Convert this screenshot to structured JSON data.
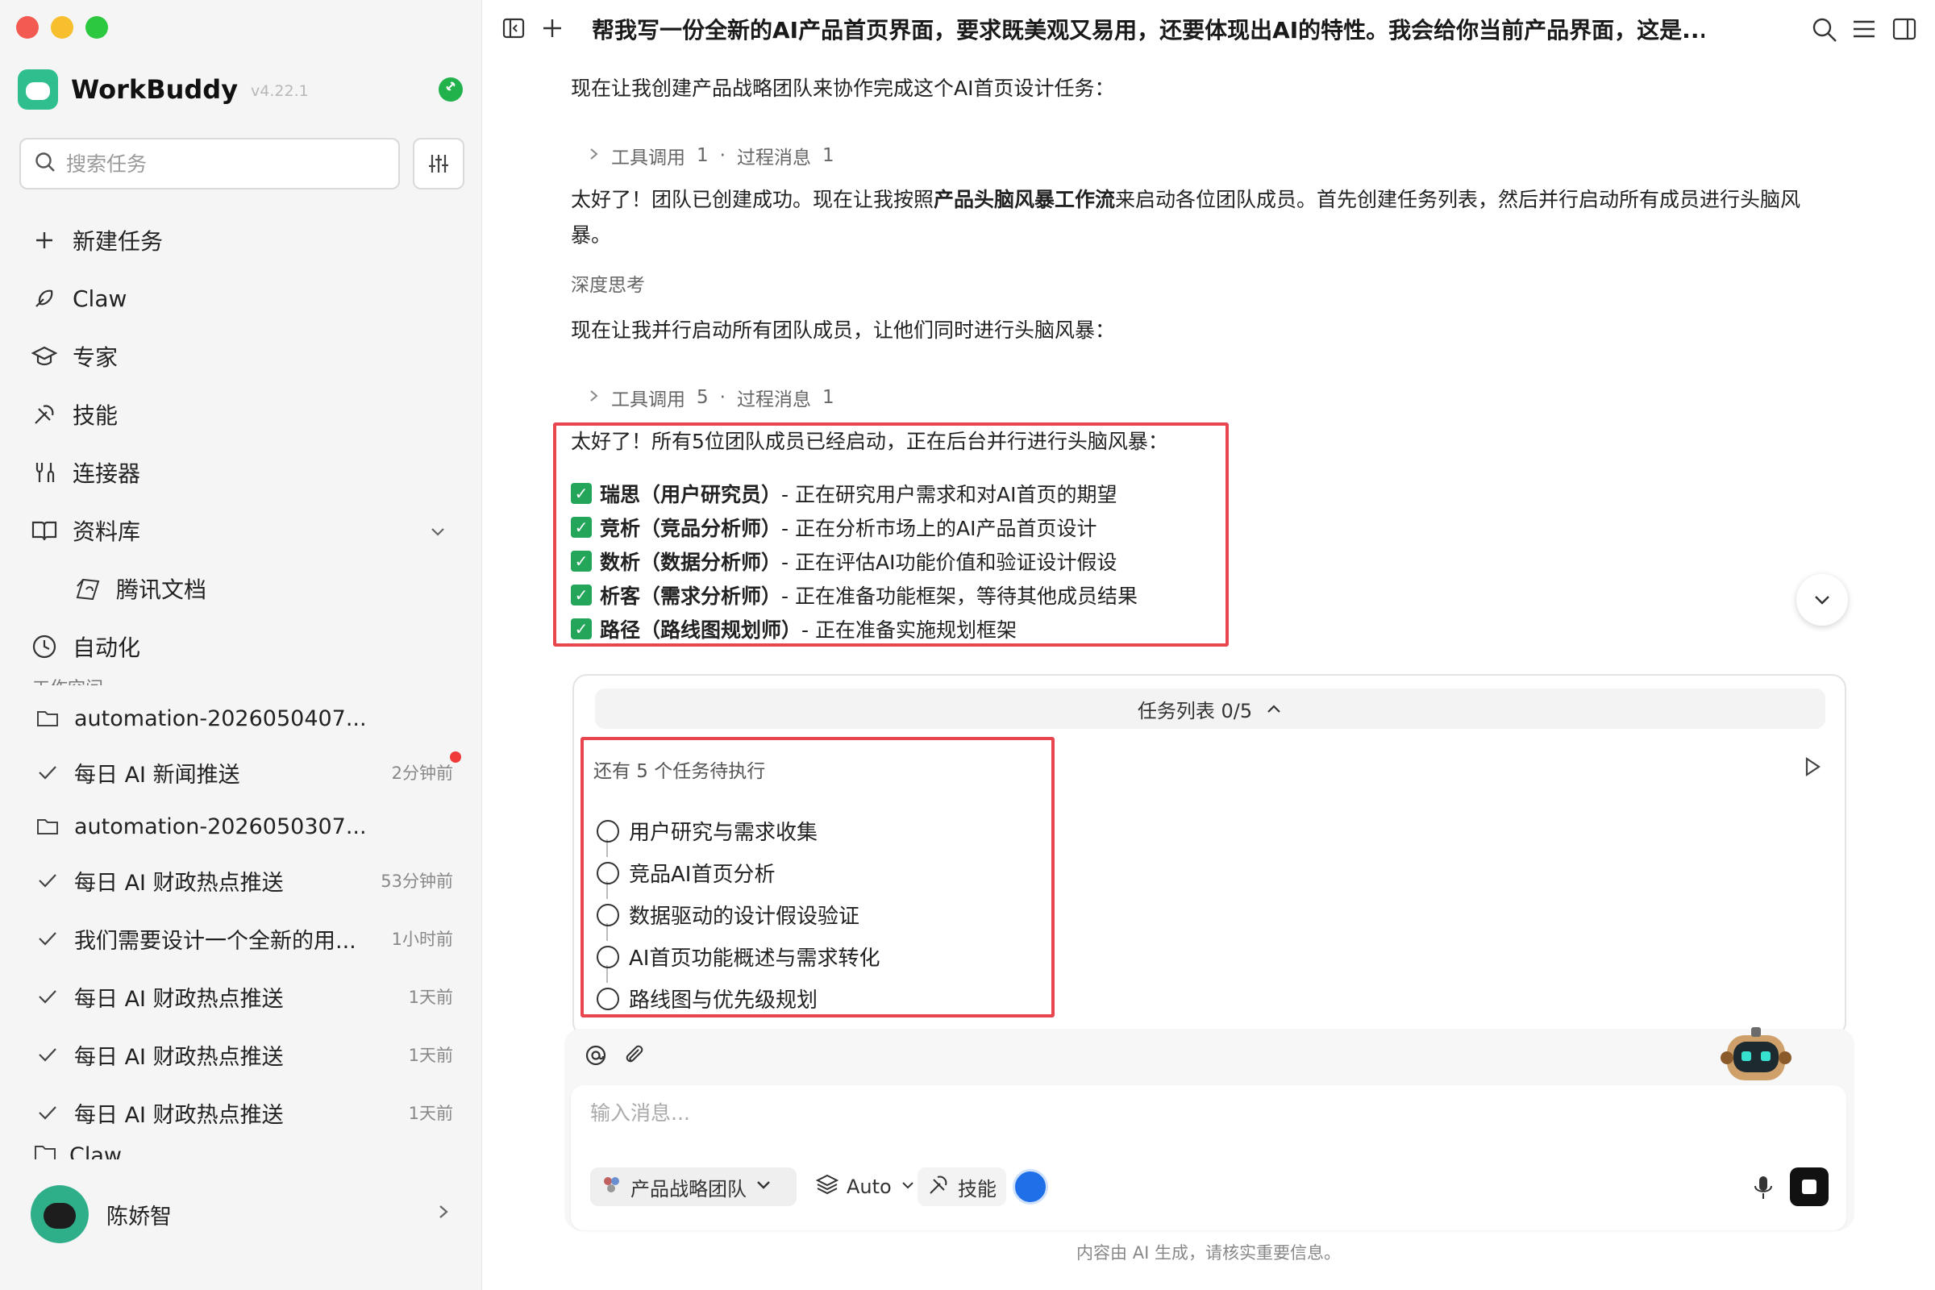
{
  "window": {
    "traffic_colors": [
      "#f25a52",
      "#f7bf2e",
      "#2bc840"
    ]
  },
  "sidebar": {
    "app_name": "WorkBuddy",
    "version": "v4.22.1",
    "search_placeholder": "搜索任务",
    "nav": [
      {
        "label": "新建任务",
        "icon": "plus-icon"
      },
      {
        "label": "Claw",
        "icon": "claw-icon"
      },
      {
        "label": "专家",
        "icon": "graduation-cap-icon"
      },
      {
        "label": "技能",
        "icon": "tools-icon"
      },
      {
        "label": "连接器",
        "icon": "connector-icon"
      },
      {
        "label": "资料库",
        "icon": "book-icon"
      },
      {
        "label": "腾讯文档",
        "icon": "tencent-docs-icon"
      },
      {
        "label": "自动化",
        "icon": "clock-icon"
      }
    ],
    "section_label_cut": "工作空间",
    "tasks": [
      {
        "type": "folder",
        "label": "automation-2026050407..."
      },
      {
        "type": "task",
        "label": "每日 AI 新闻推送",
        "time": "2分钟前",
        "unread": true
      },
      {
        "type": "folder",
        "label": "automation-2026050307..."
      },
      {
        "type": "task",
        "label": "每日 AI 财政热点推送",
        "time": "53分钟前"
      },
      {
        "type": "task",
        "label": "我们需要设计一个全新的用...",
        "time": "1小时前"
      },
      {
        "type": "task",
        "label": "每日 AI 财政热点推送",
        "time": "1天前"
      },
      {
        "type": "task",
        "label": "每日 AI 财政热点推送",
        "time": "1天前"
      },
      {
        "type": "task",
        "label": "每日 AI 财政热点推送",
        "time": "1天前"
      }
    ],
    "cut_row_label": "Claw",
    "user_name": "陈娇智"
  },
  "header": {
    "title": "帮我写一份全新的AI产品首页界面，要求既美观又易用，还要体现出AI的特性。我会给你当前产品界面，这是..."
  },
  "conversation": {
    "p1": "现在让我创建产品战略团队来协作完成这个AI首页设计任务：",
    "tool1": {
      "label": "工具调用",
      "count": "1",
      "sep": "·",
      "msg_label": "过程消息",
      "msg_count": "1"
    },
    "p2_a": "太好了！团队已创建成功。现在让我按照",
    "p2_b": "产品头脑风暴工作流",
    "p2_c": "来启动各位团队成员。首先创建任务列表，然后并行启动所有成员进行头脑风",
    "p2_d": "暴。",
    "thinking": "深度思考",
    "p3": "现在让我并行启动所有团队成员，让他们同时进行头脑风暴：",
    "tool2": {
      "label": "工具调用",
      "count": "5",
      "sep": "·",
      "msg_label": "过程消息",
      "msg_count": "1"
    },
    "p4": "太好了！所有5位团队成员已经启动，正在后台并行进行头脑风暴：",
    "members": [
      {
        "name": "瑞思（用户研究员）",
        "desc": " - 正在研究用户需求和对AI首页的期望"
      },
      {
        "name": "竞析（竞品分析师）",
        "desc": " - 正在分析市场上的AI产品首页设计"
      },
      {
        "name": "数析（数据分析师）",
        "desc": " - 正在评估AI功能价值和验证设计假设"
      },
      {
        "name": "析客（需求分析师）",
        "desc": " - 正在准备功能框架，等待其他成员结果"
      },
      {
        "name": "路径（路线图规划师）",
        "desc": " - 正在准备实施规划框架"
      }
    ]
  },
  "task_panel": {
    "title": "任务列表 0/5",
    "pending": "还有 5 个任务待执行",
    "items": [
      "用户研究与需求收集",
      "竞品AI首页分析",
      "数据驱动的设计假设验证",
      "AI首页功能概述与需求转化",
      "路线图与优先级规划"
    ]
  },
  "composer": {
    "placeholder": "输入消息...",
    "team": "产品战略团队",
    "model": "Auto",
    "skills": "技能"
  },
  "footer": {
    "disclaimer": "内容由 AI 生成，请核实重要信息。"
  },
  "colors": {
    "accent_red": "#e8454f",
    "check_green": "#23a55a",
    "brand_green": "#2fbf8f"
  }
}
